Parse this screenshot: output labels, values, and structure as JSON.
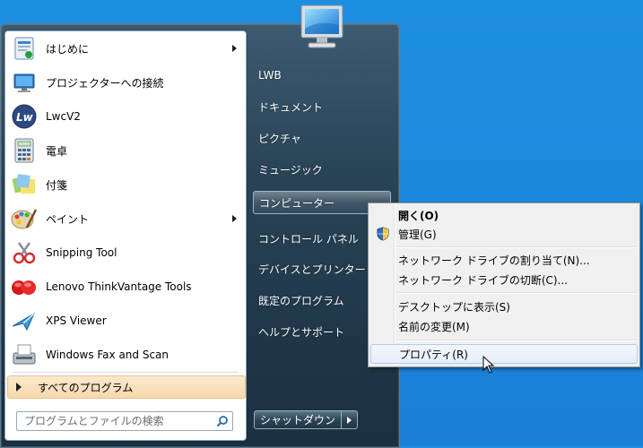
{
  "programs": [
    {
      "label": "はじめに",
      "icon": "getting-started-icon",
      "submenu": true
    },
    {
      "label": "プロジェクターへの接続",
      "icon": "projector-icon",
      "submenu": false
    },
    {
      "label": "LwcV2",
      "icon": "lwcv2-icon",
      "submenu": false
    },
    {
      "label": "電卓",
      "icon": "calculator-icon",
      "submenu": false
    },
    {
      "label": "付箋",
      "icon": "sticky-notes-icon",
      "submenu": false
    },
    {
      "label": "ペイント",
      "icon": "paint-icon",
      "submenu": true
    },
    {
      "label": "Snipping Tool",
      "icon": "snipping-tool-icon",
      "submenu": false
    },
    {
      "label": "Lenovo ThinkVantage Tools",
      "icon": "thinkvantage-icon",
      "submenu": false
    },
    {
      "label": "XPS Viewer",
      "icon": "xps-viewer-icon",
      "submenu": false
    },
    {
      "label": "Windows Fax and Scan",
      "icon": "fax-scan-icon",
      "submenu": false
    }
  ],
  "all_programs": "すべてのプログラム",
  "search": {
    "placeholder": "プログラムとファイルの検索"
  },
  "places": [
    {
      "label": "LWB"
    },
    {
      "label": "ドキュメント"
    },
    {
      "label": "ピクチャ"
    },
    {
      "label": "ミュージック"
    },
    {
      "label": "コンピューター"
    },
    {
      "label": "コントロール パネル"
    },
    {
      "label": "デバイスとプリンター"
    },
    {
      "label": "既定のプログラム"
    },
    {
      "label": "ヘルプとサポート"
    }
  ],
  "shutdown": "シャットダウン",
  "context_menu": {
    "open": "開く(O)",
    "manage": "管理(G)",
    "map_drive": "ネットワーク ドライブの割り当て(N)...",
    "disconnect_drive": "ネットワーク ドライブの切断(C)...",
    "show_desktop": "デスクトップに表示(S)",
    "rename": "名前の変更(M)",
    "properties": "プロパティ(R)"
  }
}
